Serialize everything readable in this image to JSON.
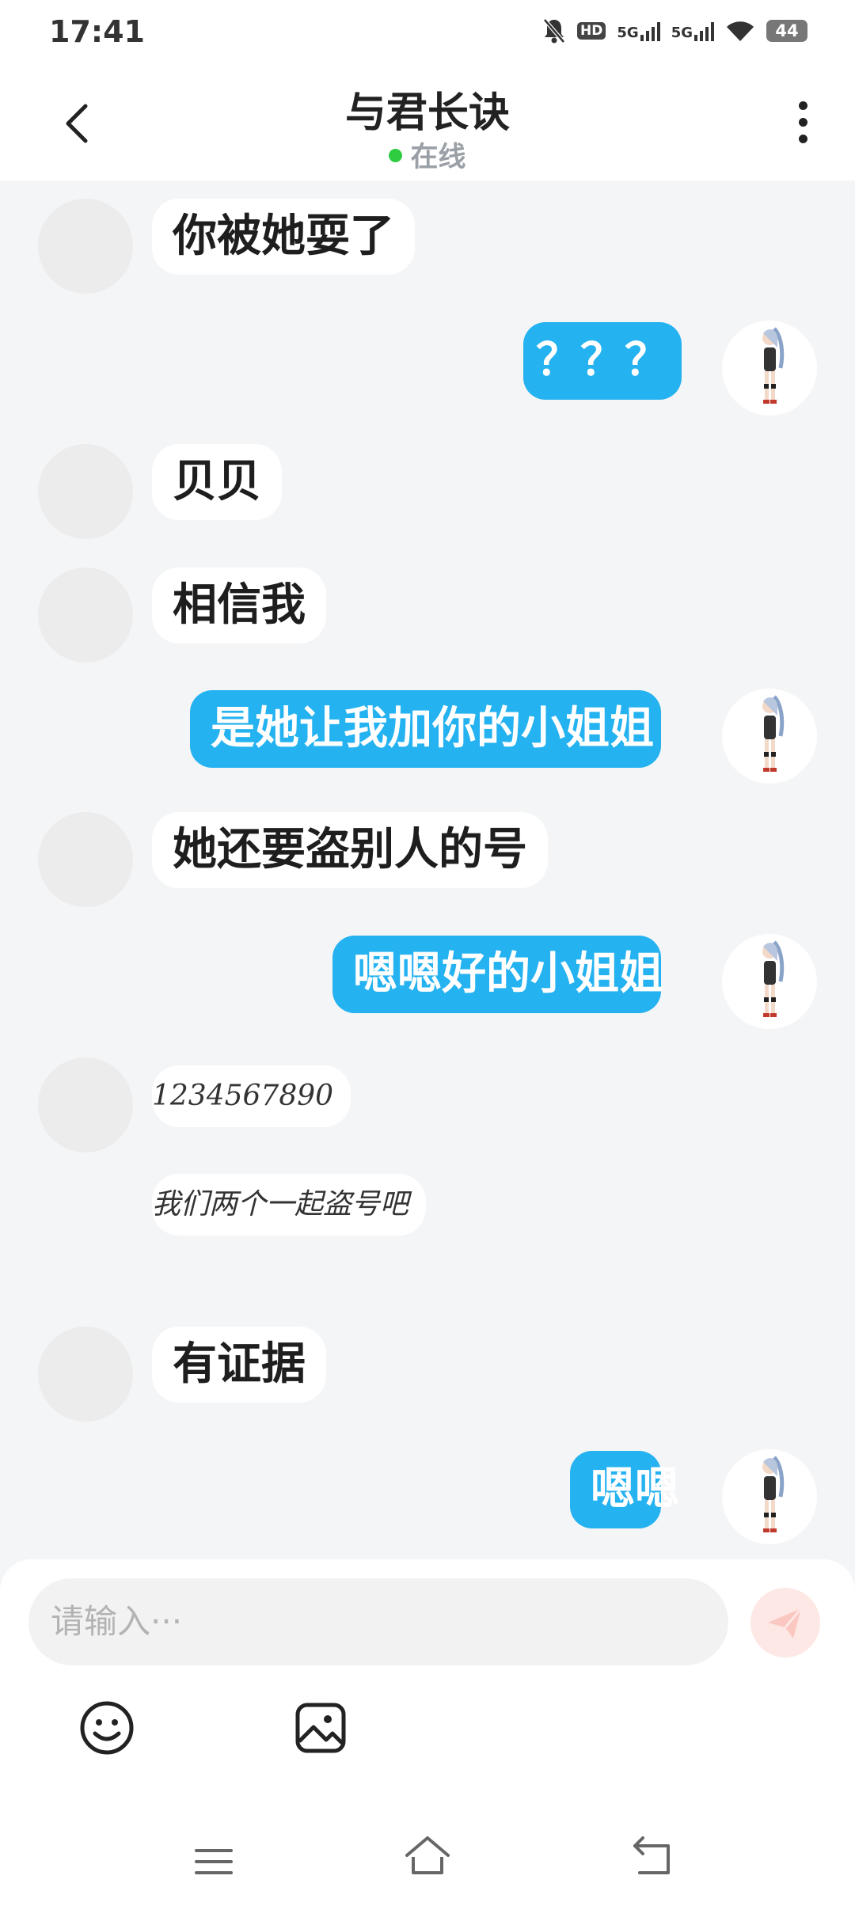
{
  "status_bar": {
    "time": "17:41",
    "network_1": "5G",
    "network_2": "5G",
    "battery": "44",
    "hd_label": "HD"
  },
  "header": {
    "title": "与君长诀",
    "status": "在线"
  },
  "messages": [
    {
      "side": "in",
      "text": "你被她耍了"
    },
    {
      "side": "out",
      "text": "？？？"
    },
    {
      "side": "in",
      "text": "贝贝"
    },
    {
      "side": "in",
      "text": "相信我"
    },
    {
      "side": "out",
      "text": "是她让我加你的小姐姐"
    },
    {
      "side": "in",
      "text": "她还要盗别人的号"
    },
    {
      "side": "out",
      "text": "嗯嗯好的小姐姐"
    },
    {
      "side": "in",
      "kind": "handwriting",
      "lines": [
        "1234567890",
        "我们两个一起盗号吧"
      ]
    },
    {
      "side": "in",
      "text": "有证据"
    },
    {
      "side": "out",
      "text": "嗯嗯"
    }
  ],
  "composer": {
    "placeholder": "请输入···"
  },
  "icons": {
    "back": "chevron-left-icon",
    "more": "more-vertical-icon",
    "send": "send-icon",
    "emoji": "emoji-icon",
    "image": "image-icon"
  },
  "colors": {
    "outgoing_bubble": "#24b2f0",
    "incoming_bubble": "#ffffff",
    "online_dot": "#2ecc40",
    "send_button": "#fde8e6"
  }
}
